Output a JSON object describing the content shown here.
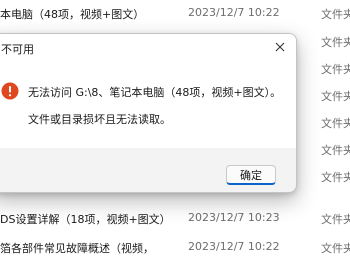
{
  "explorer": {
    "rows": [
      {
        "name": "本电脑（48项，视频+图文）",
        "date": "2023/12/7 10:22",
        "type": "文件夹"
      },
      {
        "name": "",
        "date": "",
        "type": "文件夹"
      },
      {
        "name": "",
        "date": "",
        "type": "文件夹"
      },
      {
        "name": "",
        "date": "",
        "type": "文件夹"
      },
      {
        "name": "",
        "date": "",
        "type": "文件夹"
      },
      {
        "name": "",
        "date": "",
        "type": "文件夹"
      },
      {
        "name": "",
        "date": "",
        "type": "文件夹"
      },
      {
        "name": "DS设置详解（18项，视频+图文）",
        "date": "2023/12/7 10:23",
        "type": "文件夹"
      },
      {
        "name": "箔各部件常见故障概述（视频，",
        "date": "2023/12/7 10:22",
        "type": "文件夹"
      }
    ]
  },
  "dialog": {
    "title": "不可用",
    "message_line1": "无法访问 G:\\8、笔记本电脑（48项，视频+图文）。",
    "message_line2": "文件或目录损坏且无法读取。",
    "ok_label": "确定",
    "icon": "error-icon",
    "colors": {
      "error_icon": "#e0461f",
      "button_accent": "#0a64c9"
    }
  }
}
